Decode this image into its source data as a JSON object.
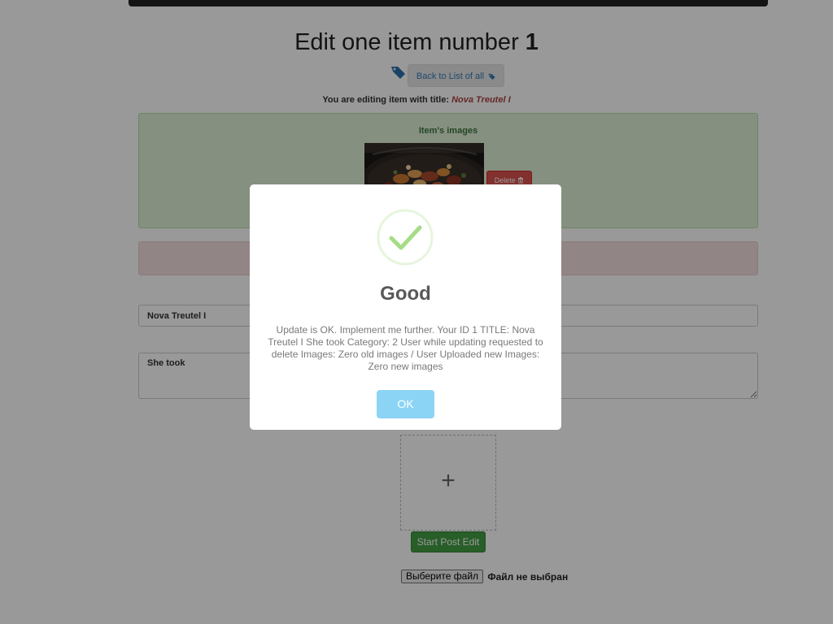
{
  "page": {
    "title_prefix": "Edit one item number ",
    "item_number": "1",
    "back_button_label": "Back to List of all",
    "editing_label": "You are editing item with title: ",
    "editing_title": "Nova Treutel I"
  },
  "images_panel": {
    "title": "Item's images",
    "delete_label": "Delete"
  },
  "form": {
    "title_value": "Nova Treutel I",
    "description_value": "She took",
    "dropzone_symbol": "+",
    "submit_label": "Start Post Edit",
    "file_button_label": "Выберите файл",
    "file_status": "Файл не выбран"
  },
  "modal": {
    "title": "Good",
    "message": "Update is OK. Implement me further. Your ID 1 TITLE: Nova Treutel I She took Category: 2 User while updating requested to delete Images: Zero old images / User Uploaded new Images: Zero new images",
    "ok_label": "OK"
  },
  "icons": {
    "tag": "tag-icon",
    "trash": "trash-icon",
    "success": "check-icon"
  },
  "colors": {
    "link_blue": "#337ab7",
    "success_bg": "#dff0d8",
    "danger": "#d9534f",
    "danger_bg": "#f2dede",
    "submit_green": "#449d44",
    "ok_button": "#8cd4f5",
    "check_green": "#a5dc86"
  }
}
